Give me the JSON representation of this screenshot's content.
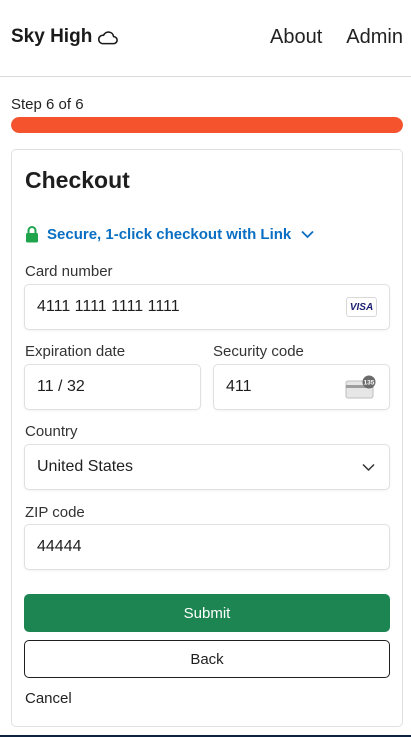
{
  "header": {
    "brand": "Sky High",
    "brand_icon": "cloud-icon",
    "nav": {
      "about": "About",
      "admin": "Admin"
    }
  },
  "progress": {
    "step_text": "Step 6 of 6",
    "fraction": 1.0,
    "color": "#f5532d"
  },
  "checkout": {
    "title": "Checkout",
    "link_text": "Secure, 1-click checkout with Link",
    "link_color": "#0a6fc2",
    "lock_color": "#1ea54c",
    "card_number": {
      "label": "Card number",
      "value": "4111 1111 1111 1111",
      "brand": "VISA"
    },
    "expiration": {
      "label": "Expiration date",
      "value": "11 / 32"
    },
    "security": {
      "label": "Security code",
      "value": "411",
      "badge": "135"
    },
    "country": {
      "label": "Country",
      "value": "United States"
    },
    "zip": {
      "label": "ZIP code",
      "value": "44444"
    },
    "submit_label": "Submit",
    "submit_color": "#1c8551",
    "back_label": "Back",
    "cancel_label": "Cancel"
  }
}
